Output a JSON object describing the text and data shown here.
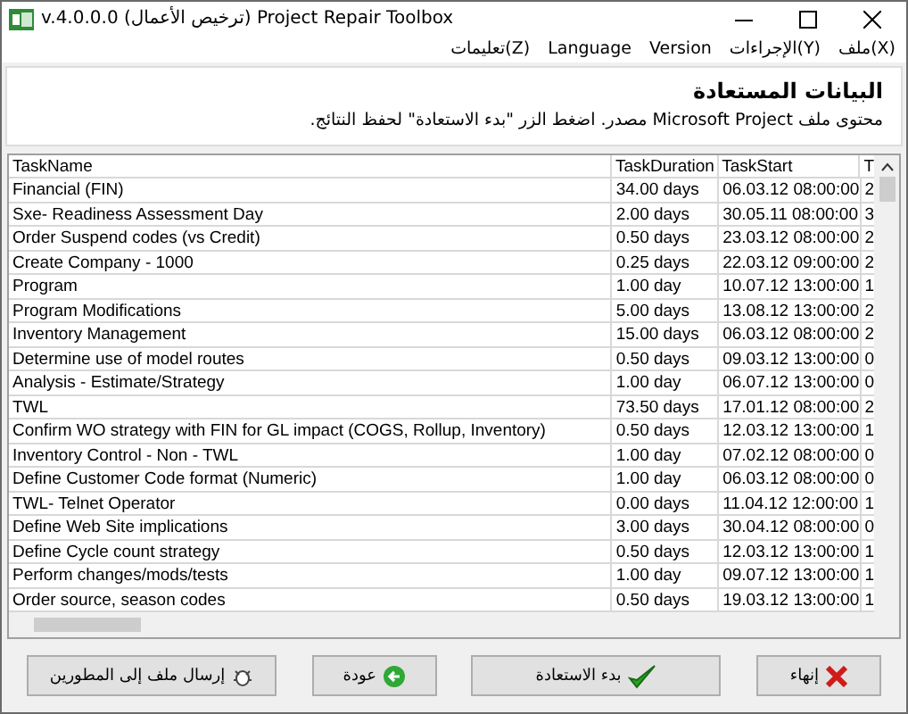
{
  "window": {
    "title": "v.4.0.0.0 (ترخيص الأعمال) Project Repair Toolbox"
  },
  "menu": [
    "ملف(X)",
    "الإجراءات(Y)",
    "Version",
    "Language",
    "تعليمات(Z)"
  ],
  "header": {
    "title": "البيانات المستعادة",
    "description": "محتوى ملف Microsoft Project مصدر. اضغط الزر \"بدء الاستعادة\" لحفظ النتائج."
  },
  "table": {
    "columns": [
      "TaskName",
      "TaskDuration",
      "TaskStart",
      "T"
    ],
    "rows": [
      [
        "Financial (FIN)",
        "34.00 days",
        "06.03.12 08:00:00",
        "2"
      ],
      [
        "Sxe- Readiness Assessment Day",
        "2.00 days",
        "30.05.11 08:00:00",
        "3"
      ],
      [
        "Order Suspend codes (vs Credit)",
        "0.50 days",
        "23.03.12 08:00:00",
        "2"
      ],
      [
        "Create Company - 1000",
        "0.25 days",
        "22.03.12 09:00:00",
        "2"
      ],
      [
        "Program",
        "1.00 day",
        "10.07.12 13:00:00",
        "1"
      ],
      [
        "Program Modifications",
        "5.00 days",
        "13.08.12 13:00:00",
        "2"
      ],
      [
        "Inventory Management",
        "15.00 days",
        "06.03.12 08:00:00",
        "2"
      ],
      [
        "Determine use of model routes",
        "0.50 days",
        "09.03.12 13:00:00",
        "0"
      ],
      [
        "Analysis - Estimate/Strategy",
        "1.00 day",
        "06.07.12 13:00:00",
        "0"
      ],
      [
        "TWL",
        "73.50 days",
        "17.01.12 08:00:00",
        "2"
      ],
      [
        "Confirm WO strategy with FIN for GL impact (COGS, Rollup, Inventory)",
        "0.50 days",
        "12.03.12 13:00:00",
        "1"
      ],
      [
        "Inventory Control - Non - TWL",
        "1.00 day",
        "07.02.12 08:00:00",
        "0"
      ],
      [
        "Define Customer Code format (Numeric)",
        "1.00 day",
        "06.03.12 08:00:00",
        "0"
      ],
      [
        "TWL- Telnet Operator",
        "0.00 days",
        "11.04.12 12:00:00",
        "1"
      ],
      [
        "Define Web Site implications",
        "3.00 days",
        "30.04.12 08:00:00",
        "0"
      ],
      [
        "Define Cycle count strategy",
        "0.50 days",
        "12.03.12 13:00:00",
        "1"
      ],
      [
        "Perform changes/mods/tests",
        "1.00 day",
        "09.07.12 13:00:00",
        "1"
      ],
      [
        "Order source, season codes",
        "0.50 days",
        "19.03.12 13:00:00",
        "1"
      ]
    ]
  },
  "buttons": [
    {
      "label": "إنهاء",
      "kind": "finish"
    },
    {
      "label": "بدء الاستعادة",
      "kind": "start"
    },
    {
      "label": "عودة",
      "kind": "back"
    },
    {
      "label": "إرسال ملف إلى المطورين",
      "kind": "send"
    }
  ]
}
